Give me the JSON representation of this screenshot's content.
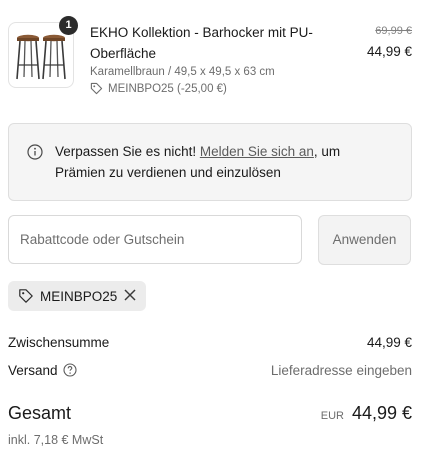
{
  "cart_item": {
    "quantity": "1",
    "title": "EKHO Kollektion - Barhocker mit PU-Oberfläche",
    "variant": "Karamellbraun / 49,5 x 49,5 x 63 cm",
    "discount_tag": "MEINBPO25 (-25,00 €)",
    "compare_price": "69,99 €",
    "price": "44,99 €",
    "image_icon": "bar-stools-image"
  },
  "notice": {
    "prefix": "Verpassen Sie es nicht! ",
    "link": "Melden Sie sich an",
    "suffix": ", um Prämien zu verdienen und einzulösen",
    "icon": "info-icon"
  },
  "discount": {
    "placeholder": "Rabattcode oder Gutschein",
    "apply_label": "Anwenden",
    "applied_code": "MEINBPO25"
  },
  "summary": {
    "subtotal_label": "Zwischensumme",
    "subtotal_value": "44,99 €",
    "shipping_label": "Versand",
    "shipping_value": "Lieferadresse eingeben",
    "total_label": "Gesamt",
    "total_currency": "EUR",
    "total_value": "44,99 €",
    "tax_note": "inkl. 7,18 € MwSt"
  },
  "colors": {
    "text": "#1a1a1a",
    "muted": "#6d6d6d",
    "badge": "#2b2b2b",
    "panel": "#f5f5f5",
    "chip": "#ececec",
    "stool_seat": "#8a5a36"
  }
}
